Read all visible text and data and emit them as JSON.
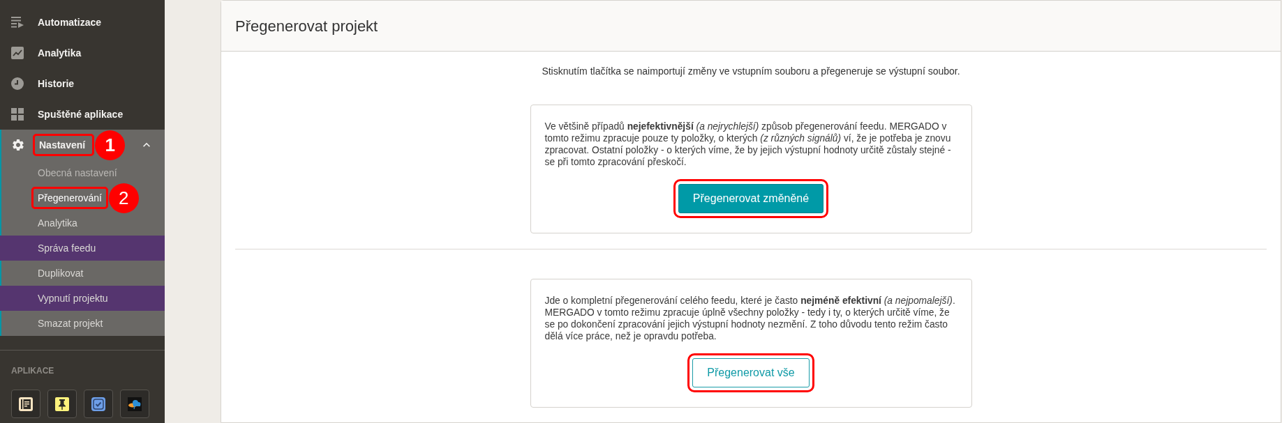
{
  "sidebar": {
    "items": [
      {
        "label": "Automatizace",
        "selected": false
      },
      {
        "label": "Analytika",
        "selected": false
      },
      {
        "label": "Historie",
        "selected": false
      },
      {
        "label": "Spuštěné aplikace",
        "selected": false
      },
      {
        "label": "Nastavení",
        "selected": true,
        "expanded": true,
        "callout": "1",
        "children": [
          {
            "label": "Obecná nastavení",
            "selected": false,
            "disabled": true,
            "highlighted": false
          },
          {
            "label": "Přegenerování",
            "selected": true,
            "disabled": false,
            "highlighted": false,
            "callout": "2"
          },
          {
            "label": "Analytika",
            "selected": false,
            "disabled": false,
            "highlighted": false
          },
          {
            "label": "Správa feedu",
            "selected": false,
            "disabled": false,
            "highlighted": true
          },
          {
            "label": "Duplikovat",
            "selected": false,
            "disabled": false,
            "highlighted": false
          },
          {
            "label": "Vypnutí projektu",
            "selected": false,
            "disabled": false,
            "highlighted": true
          },
          {
            "label": "Smazat projekt",
            "selected": false,
            "disabled": false,
            "highlighted": false
          }
        ]
      }
    ]
  },
  "apps": {
    "heading": "APLIKACE"
  },
  "page": {
    "title": "Přegenerovat projekt",
    "intro": "Stisknutím tlačítka se naimportují změny ve vstupním souboru a přegeneruje se výstupní soubor.",
    "options": [
      {
        "description": "Ve většině případů **nejefektivnější** *(a nejrychlejší)* způsob přegenerování feedu. MERGADO v tomto režimu zpracuje pouze ty položky, o kterých *(z různých signálů)* ví, že je potřeba je znovu zpracovat. Ostatní položky - o kterých víme, že by jejich výstupní hodnoty určitě zůstaly stejné - se při tomto zpracování přeskočí.",
        "button": {
          "label": "Přegenerovat změněné",
          "kind": "primary",
          "annotated": true
        }
      },
      {
        "description": "Jde o kompletní přegenerování celého feedu, které je často **nejméně efektivní** *(a nejpomalejší)*. MERGADO v tomto režimu zpracuje úplně všechny položky - tedy i ty, o kterých určitě víme, že se po dokončení zpracování jejich výstupní hodnoty nezmění. Z toho důvodu tento režim často dělá více práce, než je opravdu potřeba.",
        "button": {
          "label": "Přegenerovat vše",
          "kind": "outline",
          "annotated": true
        }
      }
    ]
  }
}
